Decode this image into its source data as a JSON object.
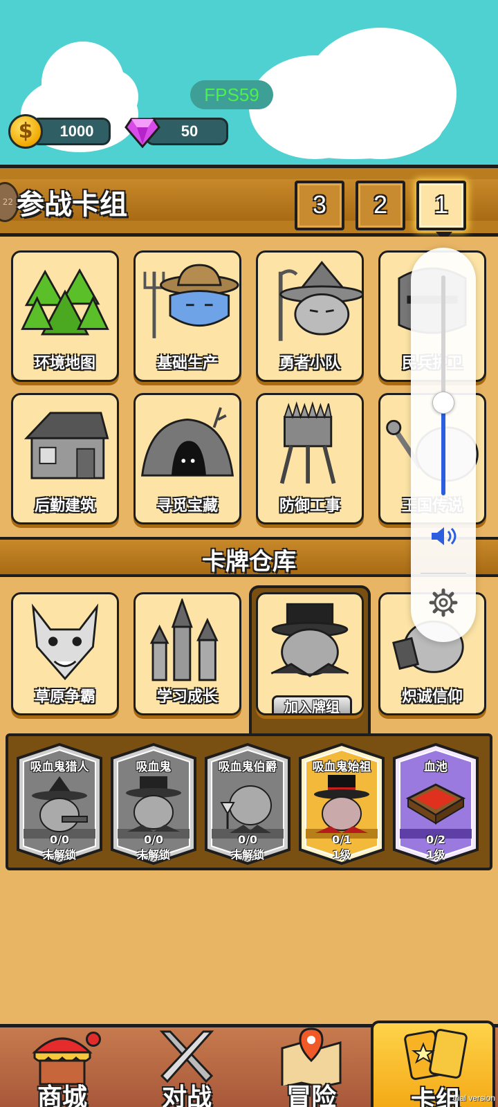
{
  "hud": {
    "fps": "FPS59",
    "gold": "1000",
    "gems": "50"
  },
  "deck": {
    "title": "参战卡组",
    "level_badge": "22",
    "tabs": [
      "3",
      "2",
      "1"
    ],
    "active_tab": "1"
  },
  "deck_cards": [
    {
      "label": "环境地图",
      "icon": "forest-icon"
    },
    {
      "label": "基础生产",
      "icon": "farmer-icon"
    },
    {
      "label": "勇者小队",
      "icon": "wizard-icon"
    },
    {
      "label": "民兵护卫",
      "icon": "knight-icon"
    },
    {
      "label": "后勤建筑",
      "icon": "house-icon"
    },
    {
      "label": "寻觅宝藏",
      "icon": "cave-icon"
    },
    {
      "label": "防御工事",
      "icon": "watchtower-icon"
    },
    {
      "label": "王国传说",
      "icon": "king-icon"
    }
  ],
  "warehouse": {
    "title": "卡牌仓库",
    "categories": [
      {
        "label": "草原争霸",
        "icon": "wolf-icon"
      },
      {
        "label": "学习成长",
        "icon": "castle-icon"
      },
      {
        "label": "",
        "icon": "vampire-icon",
        "button": "加入牌组"
      },
      {
        "label": "炽诚信仰",
        "icon": "priest-icon"
      }
    ],
    "cards": [
      {
        "name": "吸血鬼猎人",
        "count": "0/0",
        "status": "未解锁",
        "tier": "gray"
      },
      {
        "name": "吸血鬼",
        "count": "0/0",
        "status": "未解锁",
        "tier": "gray"
      },
      {
        "name": "吸血鬼伯爵",
        "count": "0/0",
        "status": "未解锁",
        "tier": "gray"
      },
      {
        "name": "吸血鬼始祖",
        "count": "0/1",
        "status": "1级",
        "tier": "gold"
      },
      {
        "name": "血池",
        "count": "0/2",
        "status": "1级",
        "tier": "purple"
      }
    ]
  },
  "nav": [
    {
      "label": "商城",
      "icon": "shop-icon",
      "badge": true
    },
    {
      "label": "对战",
      "icon": "crossed-swords-icon"
    },
    {
      "label": "冒险",
      "icon": "map-icon"
    },
    {
      "label": "卡组",
      "icon": "cards-icon",
      "active": true
    }
  ],
  "volume": {
    "level": 0.42
  },
  "watermark": "trial version",
  "colors": {
    "sky": "#4fd0d1",
    "panel": "#e8b564",
    "card": "#fde4a6",
    "accent": "#2b5fe0"
  }
}
